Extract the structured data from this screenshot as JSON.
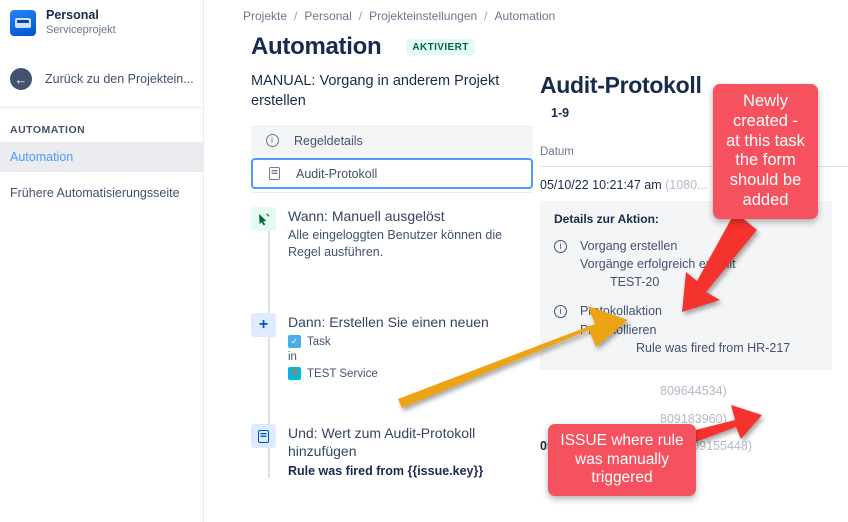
{
  "sidebar": {
    "project": {
      "name": "Personal",
      "type": "Serviceprojekt",
      "avatar_icon": "project-avatar-icon"
    },
    "back": {
      "label": "Zurück zu den Projektein...",
      "icon": "back-arrow-icon"
    },
    "section_label": "AUTOMATION",
    "items": [
      {
        "label": "Automation",
        "active": true
      },
      {
        "label": "Frühere Automatisierungsseite",
        "active": false
      }
    ]
  },
  "breadcrumb": [
    "Projekte",
    "Personal",
    "Projekteinstellungen",
    "Automation"
  ],
  "header": {
    "title": "Automation",
    "status_badge": "AKTIVIERT"
  },
  "rule": {
    "name": "MANUAL: Vorgang in anderem Projekt erstellen",
    "tabs": [
      {
        "label": "Regeldetails",
        "icon": "info-circle-icon",
        "selected": false
      },
      {
        "label": "Audit-Protokoll",
        "icon": "document-icon",
        "selected": true
      }
    ],
    "steps": [
      {
        "icon": "cursor-trigger-icon",
        "title": "Wann: Manuell ausgelöst",
        "sub": "Alle eingeloggten Benutzer können die Regel ausführen."
      },
      {
        "icon": "plus-icon",
        "title": "Dann: Erstellen Sie einen neuen",
        "item_type": "Task",
        "in_word": "in",
        "item_project": "TEST Service"
      },
      {
        "icon": "document-icon",
        "title": "Und: Wert zum Audit-Protokoll hinzufügen",
        "bold_value": "Rule was fired from {{issue.key}}"
      }
    ]
  },
  "audit": {
    "title": "Audit-Protokoll",
    "count": "1-9",
    "column_header": "Datum",
    "entries": [
      {
        "time": "05/10/22 10:21:47 am",
        "id": "(1080...",
        "bold": false
      },
      {
        "time": "",
        "id": "809644534)",
        "bold": false
      },
      {
        "time": "",
        "id": "809183960)",
        "bold": false
      },
      {
        "time": "05/10/22 09:58:01 am",
        "id": "(10809155448)",
        "bold": true
      }
    ],
    "detail": {
      "heading": "Details zur Aktion:",
      "groups": [
        {
          "icon": "info-circle-icon",
          "title": "Vorgang erstellen",
          "line": "Vorgänge erfolgreich erstellt",
          "value": "TEST-20"
        },
        {
          "icon": "info-circle-icon",
          "title": "Protokollaktion",
          "line": "Protokollieren",
          "value": "Rule was fired from HR-217"
        }
      ]
    }
  },
  "annotations": {
    "callout_1": "Newly created -\nat this task\nthe form\nshould be\nadded",
    "callout_1_lines": [
      "Newly",
      "created -",
      "at this task",
      "the form",
      "should be",
      "added"
    ],
    "callout_2_lines": [
      "ISSUE where rule",
      "was manually",
      "triggered"
    ],
    "colors": {
      "callout_bg": "#f5515f",
      "orange_arrow": "#eda318",
      "red_arrow": "#f5332e"
    }
  }
}
